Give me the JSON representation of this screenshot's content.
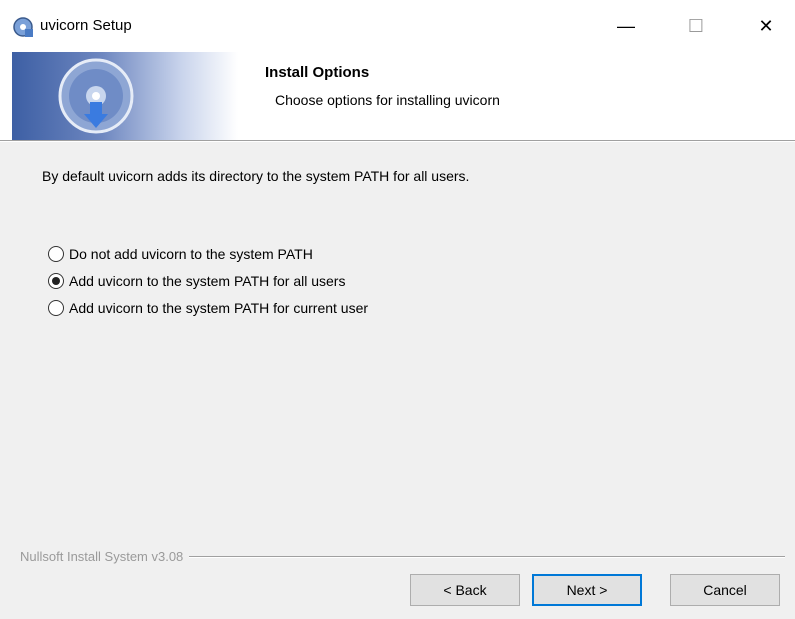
{
  "window": {
    "title": "uvicorn Setup",
    "icon": "installer-icon",
    "controls": [
      "minimize-icon",
      "maximize-icon",
      "close-icon"
    ],
    "control_glyphs": {
      "minimize": "—",
      "maximize": "☐",
      "close": "✕"
    }
  },
  "header": {
    "title": "Install Options",
    "subtitle": "Choose options for installing uvicorn",
    "banner_icon": "install-disc-icon"
  },
  "body": {
    "description": "By default uvicorn adds its directory to the system PATH for all users.",
    "options": [
      {
        "label": "Do not add uvicorn to the system PATH",
        "checked": false
      },
      {
        "label": "Add uvicorn to the system PATH for all users",
        "checked": true
      },
      {
        "label": "Add uvicorn to the system PATH for current user",
        "checked": false
      }
    ]
  },
  "footer": {
    "branding": "Nullsoft Install System v3.08"
  },
  "buttons": {
    "back": "< Back",
    "next": "Next >",
    "cancel": "Cancel"
  },
  "colors": {
    "focus_border": "#0078d7",
    "banner_dark": "#3d5fa4"
  }
}
